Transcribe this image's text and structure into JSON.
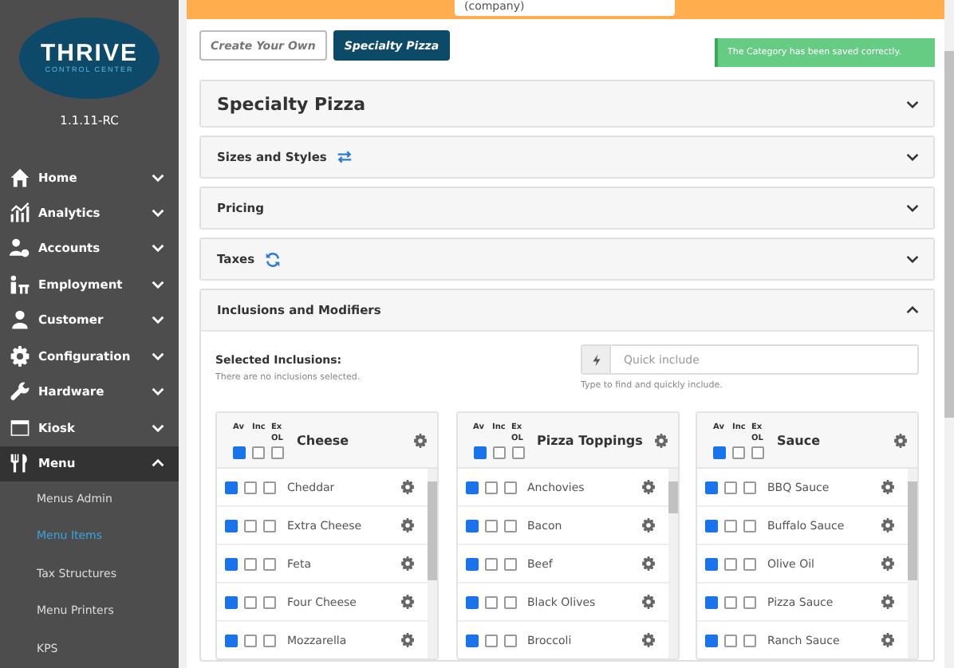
{
  "top_bar": {
    "company_field": "(company)"
  },
  "logo": {
    "title": "THRIVE",
    "subtitle": "CONTROL CENTER"
  },
  "version": "1.1.11-RC",
  "sidebar": {
    "items": [
      {
        "label": "Home",
        "expanded": false
      },
      {
        "label": "Analytics",
        "expanded": false
      },
      {
        "label": "Accounts",
        "expanded": false
      },
      {
        "label": "Employment",
        "expanded": false
      },
      {
        "label": "Customer",
        "expanded": false
      },
      {
        "label": "Configuration",
        "expanded": false
      },
      {
        "label": "Hardware",
        "expanded": false
      },
      {
        "label": "Kiosk",
        "expanded": false
      },
      {
        "label": "Menu",
        "expanded": true,
        "children": [
          {
            "label": "Menus Admin",
            "selected": false
          },
          {
            "label": "Menu Items",
            "selected": true
          },
          {
            "label": "Tax Structures",
            "selected": false
          },
          {
            "label": "Menu Printers",
            "selected": false
          },
          {
            "label": "KPS",
            "selected": false
          }
        ]
      }
    ]
  },
  "category_tabs": [
    {
      "label": "Create Your Own",
      "selected": false
    },
    {
      "label": "Specialty Pizza",
      "selected": true
    }
  ],
  "toast": "The Category has been saved correctly.",
  "panels": [
    {
      "title": "Specialty Pizza",
      "kind": "main",
      "expanded": false
    },
    {
      "title": "Sizes and Styles",
      "kind": "swap",
      "expanded": false
    },
    {
      "title": "Pricing",
      "kind": "plain",
      "expanded": false
    },
    {
      "title": "Taxes",
      "kind": "refresh",
      "expanded": false
    },
    {
      "title": "Inclusions and Modifiers",
      "kind": "plain",
      "expanded": true
    }
  ],
  "inclusions": {
    "label": "Selected Inclusions:",
    "empty_note": "There are no inclusions selected.",
    "quick_include": {
      "placeholder": "Quick include",
      "help": "Type to find and quickly include."
    },
    "groups": [
      {
        "title": "Cheese",
        "columns": [
          "Av",
          "Inc",
          "Ex OL"
        ],
        "all_available": true,
        "all_include": false,
        "all_exclude": false,
        "items": [
          {
            "name": "Cheddar",
            "available": true,
            "include": false,
            "exclude": false
          },
          {
            "name": "Extra Cheese",
            "available": true,
            "include": false,
            "exclude": false
          },
          {
            "name": "Feta",
            "available": true,
            "include": false,
            "exclude": false
          },
          {
            "name": "Four Cheese",
            "available": true,
            "include": false,
            "exclude": false
          },
          {
            "name": "Mozzarella",
            "available": true,
            "include": false,
            "exclude": false
          }
        ]
      },
      {
        "title": "Pizza Toppings",
        "columns": [
          "Av",
          "Inc",
          "Ex OL"
        ],
        "all_available": true,
        "all_include": false,
        "all_exclude": false,
        "items": [
          {
            "name": "Anchovies",
            "available": true,
            "include": false,
            "exclude": false
          },
          {
            "name": "Bacon",
            "available": true,
            "include": false,
            "exclude": false
          },
          {
            "name": "Beef",
            "available": true,
            "include": false,
            "exclude": false
          },
          {
            "name": "Black Olives",
            "available": true,
            "include": false,
            "exclude": false
          },
          {
            "name": "Broccoli",
            "available": true,
            "include": false,
            "exclude": false
          }
        ]
      },
      {
        "title": "Sauce",
        "columns": [
          "Av",
          "Inc",
          "Ex OL"
        ],
        "all_available": true,
        "all_include": false,
        "all_exclude": false,
        "items": [
          {
            "name": "BBQ Sauce",
            "available": true,
            "include": false,
            "exclude": false
          },
          {
            "name": "Buffalo Sauce",
            "available": true,
            "include": false,
            "exclude": false
          },
          {
            "name": "Olive Oil",
            "available": true,
            "include": false,
            "exclude": false
          },
          {
            "name": "Pizza Sauce",
            "available": true,
            "include": false,
            "exclude": false
          },
          {
            "name": "Ranch Sauce",
            "available": true,
            "include": false,
            "exclude": false
          }
        ]
      }
    ]
  }
}
